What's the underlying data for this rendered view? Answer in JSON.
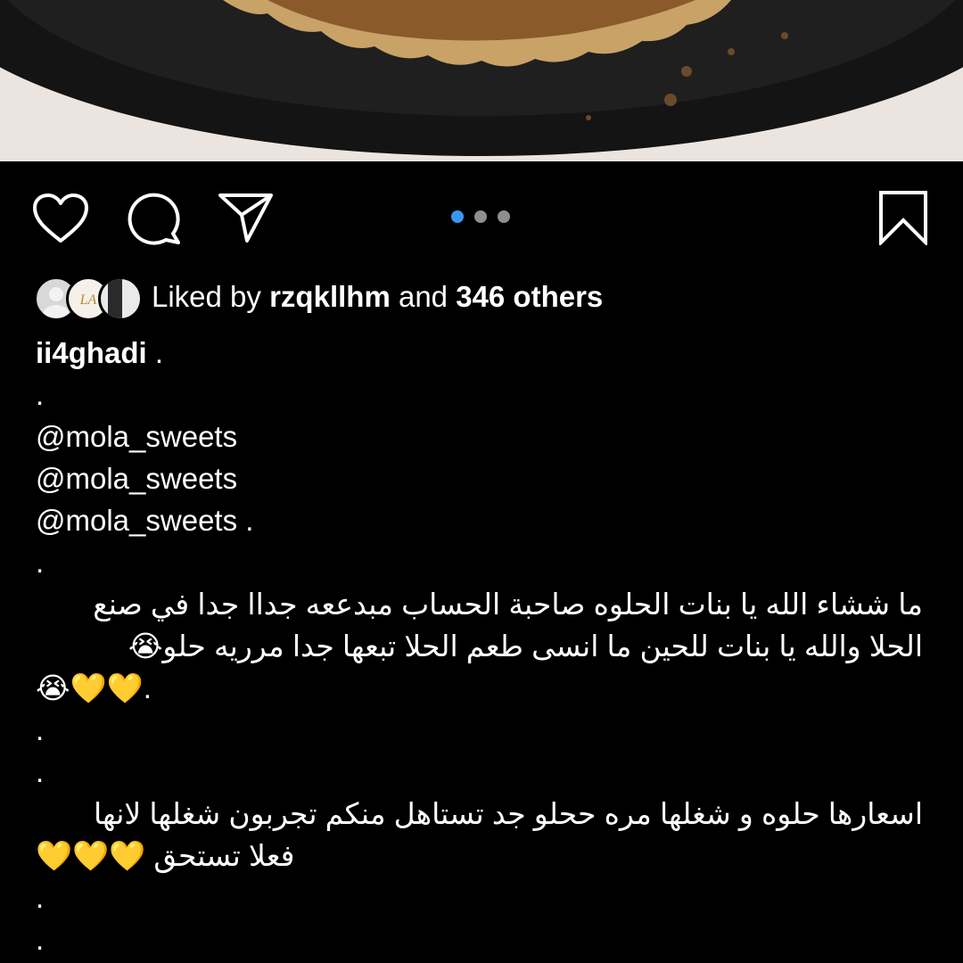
{
  "likes": {
    "prefix": "Liked by",
    "user": "rzqkllhm",
    "middle": "and",
    "count": "346 others"
  },
  "carousel": {
    "total": 3,
    "active": 0
  },
  "caption": {
    "username": "ii4ghadi",
    "username_suffix": " .",
    "dot1": ".",
    "mention1": "@mola_sweets",
    "mention2": "@mola_sweets",
    "mention3": "@mola_sweets .",
    "dot2": ".",
    "ar1": "ما ششاء الله يا بنات الحلوه صاحبة الحساب مبدععه جداا جدا في صنع",
    "ar2": "الحلا والله يا بنات للحين ما انسى طعم الحلا تبعها جدا مرريه حلو😭",
    "ar3": "😭💛💛.",
    "dot3": ".",
    "dot4": ".",
    "ar4": "اسعارها حلوه و شغلها مره ححلو جد تستاهل منكم تجربون شغلها لانها",
    "ar5": "فعلا تستحق 💛💛💛",
    "dot5": ".",
    "dot6": "."
  },
  "colors": {
    "background": "#000000",
    "text": "#ffffff",
    "dot_active": "#3897f0",
    "dot_inactive": "#8e8e8e"
  },
  "icons": [
    "heart-icon",
    "comment-icon",
    "share-icon",
    "bookmark-icon"
  ]
}
